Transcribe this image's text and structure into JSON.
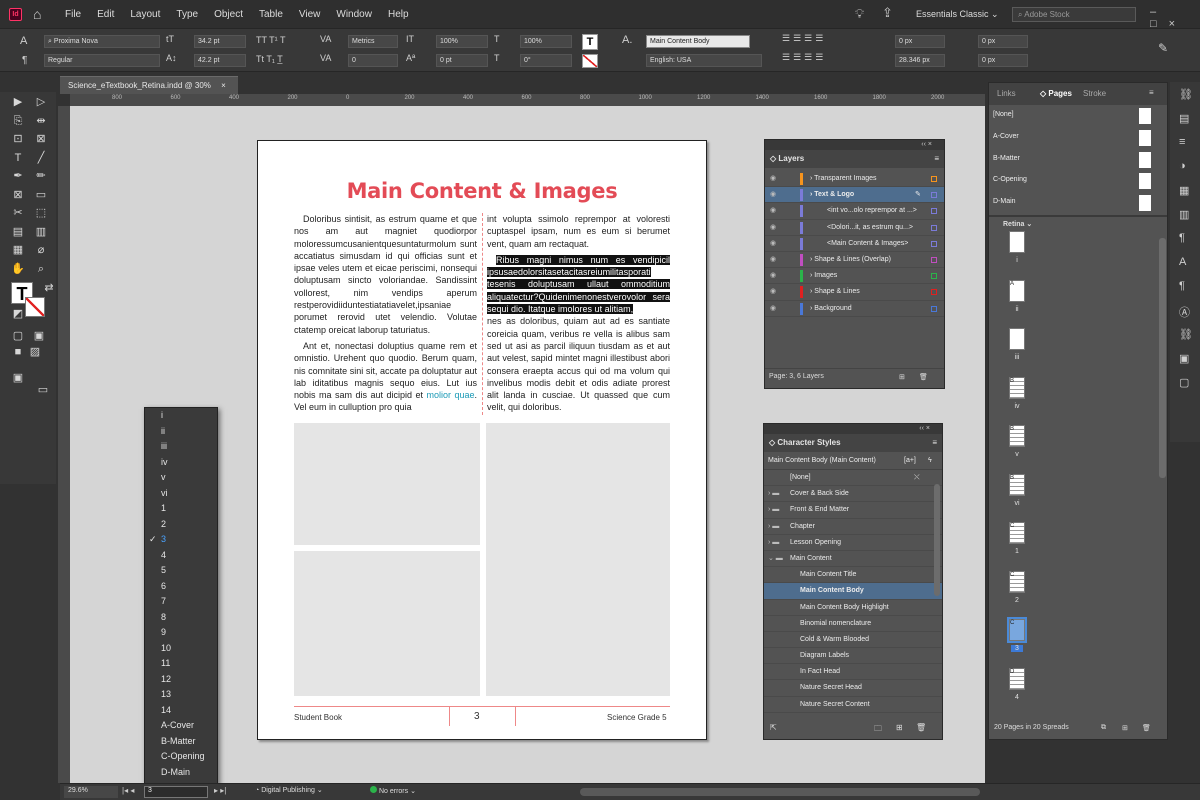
{
  "app": {
    "logo": "Id",
    "menu": [
      "File",
      "Edit",
      "Layout",
      "Type",
      "Object",
      "Table",
      "View",
      "Window",
      "Help"
    ],
    "workspace": "Essentials Classic",
    "stock_search_placeholder": "Adobe Stock"
  },
  "control": {
    "font_family": "Proxima Nova",
    "font_style": "Regular",
    "font_size": "34.2 pt",
    "leading": "42.2 pt",
    "kerning": "Metrics",
    "tracking": "0",
    "vscale": "100%",
    "hscale": "100%",
    "baseline": "0 pt",
    "skew": "0°",
    "char_style": "Main Content Body",
    "language": "English: USA",
    "indent_left": "0 px",
    "indent_right": "0 px",
    "space_before": "0 px",
    "space_after": "28.346 px"
  },
  "document": {
    "tab_title": "Science_eTextbook_Retina.indd @ 30%",
    "ruler_marks": [
      "800",
      "600",
      "400",
      "200",
      "0",
      "200",
      "400",
      "600",
      "800",
      "1000",
      "1200",
      "1400",
      "1600",
      "1800",
      "2000",
      "2200"
    ]
  },
  "page": {
    "title": "Main Content & Images",
    "col1_p1": "Doloribus sintisit, as estrum quame et que nos am aut magniet quodiorpor moloressumcusanientquesuntaturmolum sunt accatiatus simusdam id qui officias sunt et ipsae veles utem et eicae periscimi, nonsequi doluptusam sincto voloriandae. Sandissint vollorest, nim vendips aperum restperovidiiduntestiatatiavelet,ipsaniae porumet rerovid utet velendio. Volutae ctatemp oreicat laborup taturiatus.",
    "col1_p2": "Ant et, nonectasi doluptius quame rem et omnistio. Urehent quo quodio. Berum quam, nis comnitate sini sit, accate pa doluptatur aut lab iditatibus magnis sequo eius. Lut ius nobis ma sam dis aut dicipid et",
    "col1_link": "molior quae",
    "col1_tail": ". Vel eum in culluption pro quia",
    "col2_p1": "int volupta ssimolo reprempor at voloresti cuptaspel ipsam, num es eum si berumet vent, quam am rectaquat.",
    "col2_selected": "Ribus magni nimus num es vendipicil ipsusaedolorsitasetacitasreiumilitasporati tesenis doluptusam ullaut ommoditium aliquatectur?Quidenimenonestverovolor sera sequi dio. Itatque imolores ut alitiam,",
    "col2_rest": "nes as doloribus, quiam aut ad es santiate coreicia quam, veribus re vella is alibus sam sed ut asi as parcil iliquun tiusdam as et aut aut velest, sapid mintet magni illestibust abori consera eraepta accus qui od ma volum qui invelibus modis debit et odis adiate prorest alit landa in cusciae. Ut quassed que cum velit, qui doloribus.",
    "footer_left": "Student Book",
    "footer_num": "3",
    "footer_right": "Science Grade 5"
  },
  "layers": {
    "title": "Layers",
    "rows": [
      {
        "name": "Transparent Images",
        "color": "#f7941d",
        "indent": 0,
        "selected": false
      },
      {
        "name": "Text & Logo",
        "color": "#7b7bd8",
        "indent": 0,
        "selected": true
      },
      {
        "name": "<int vo...olo reprempor at ...>",
        "color": "#7b7bd8",
        "indent": 1,
        "selected": false
      },
      {
        "name": "<Dolori...it, as estrum qu...>",
        "color": "#7b7bd8",
        "indent": 1,
        "selected": false
      },
      {
        "name": "<Main Content & Images>",
        "color": "#7b7bd8",
        "indent": 1,
        "selected": false
      },
      {
        "name": "Shape & Lines (Overlap)",
        "color": "#c04ec0",
        "indent": 0,
        "selected": false
      },
      {
        "name": "Images",
        "color": "#2bb34a",
        "indent": 0,
        "selected": false
      },
      {
        "name": "Shape & Lines",
        "color": "#e02020",
        "indent": 0,
        "selected": false
      },
      {
        "name": "Background",
        "color": "#4a78d8",
        "indent": 0,
        "selected": false
      }
    ],
    "footer": "Page: 3, 6 Layers"
  },
  "charstyles": {
    "title": "Character Styles",
    "current": "Main Content Body (Main Content)",
    "new_group_label": "[a+]",
    "rows": [
      {
        "name": "[None]",
        "type": "item",
        "indent": 0,
        "selected": false
      },
      {
        "name": "Cover & Back Side",
        "type": "folder",
        "indent": 0,
        "selected": false
      },
      {
        "name": "Front & End Matter",
        "type": "folder",
        "indent": 0,
        "selected": false
      },
      {
        "name": "Chapter",
        "type": "folder",
        "indent": 0,
        "selected": false
      },
      {
        "name": "Lesson Opening",
        "type": "folder",
        "indent": 0,
        "selected": false
      },
      {
        "name": "Main Content",
        "type": "open-folder",
        "indent": 0,
        "selected": false
      },
      {
        "name": "Main Content Title",
        "type": "item",
        "indent": 1,
        "selected": false
      },
      {
        "name": "Main Content Body",
        "type": "item",
        "indent": 1,
        "selected": true
      },
      {
        "name": "Main Content Body Highlight",
        "type": "item",
        "indent": 1,
        "selected": false
      },
      {
        "name": "Binomial nomenclature",
        "type": "item",
        "indent": 1,
        "selected": false
      },
      {
        "name": "Cold & Warm Blooded",
        "type": "item",
        "indent": 1,
        "selected": false
      },
      {
        "name": "Diagram Labels",
        "type": "item",
        "indent": 1,
        "selected": false
      },
      {
        "name": "In Fact Head",
        "type": "item",
        "indent": 1,
        "selected": false
      },
      {
        "name": "Nature Secret Head",
        "type": "item",
        "indent": 1,
        "selected": false
      },
      {
        "name": "Nature Secret Content",
        "type": "item",
        "indent": 1,
        "selected": false
      }
    ]
  },
  "pages_panel": {
    "tabs": [
      "Links",
      "Pages",
      "Stroke"
    ],
    "masters": [
      "[None]",
      "A-Cover",
      "B-Matter",
      "C-Opening",
      "D-Main"
    ],
    "size_label": "Retina",
    "pages": [
      "i",
      "ii",
      "iii",
      "iv",
      "v",
      "vi",
      "1",
      "2",
      "3",
      "4"
    ],
    "footer": "20 Pages in 20 Spreads"
  },
  "dropdown": {
    "items": [
      "i",
      "ii",
      "iii",
      "iv",
      "v",
      "vi",
      "1",
      "2",
      "3",
      "4",
      "5",
      "6",
      "7",
      "8",
      "9",
      "10",
      "11",
      "12",
      "13",
      "14",
      "A-Cover",
      "B-Matter",
      "C-Opening",
      "D-Main"
    ],
    "selected": "3"
  },
  "status": {
    "zoom": "29.6%",
    "page": "3",
    "preflight_profile": "Digital Publishing",
    "errors": "No errors"
  }
}
